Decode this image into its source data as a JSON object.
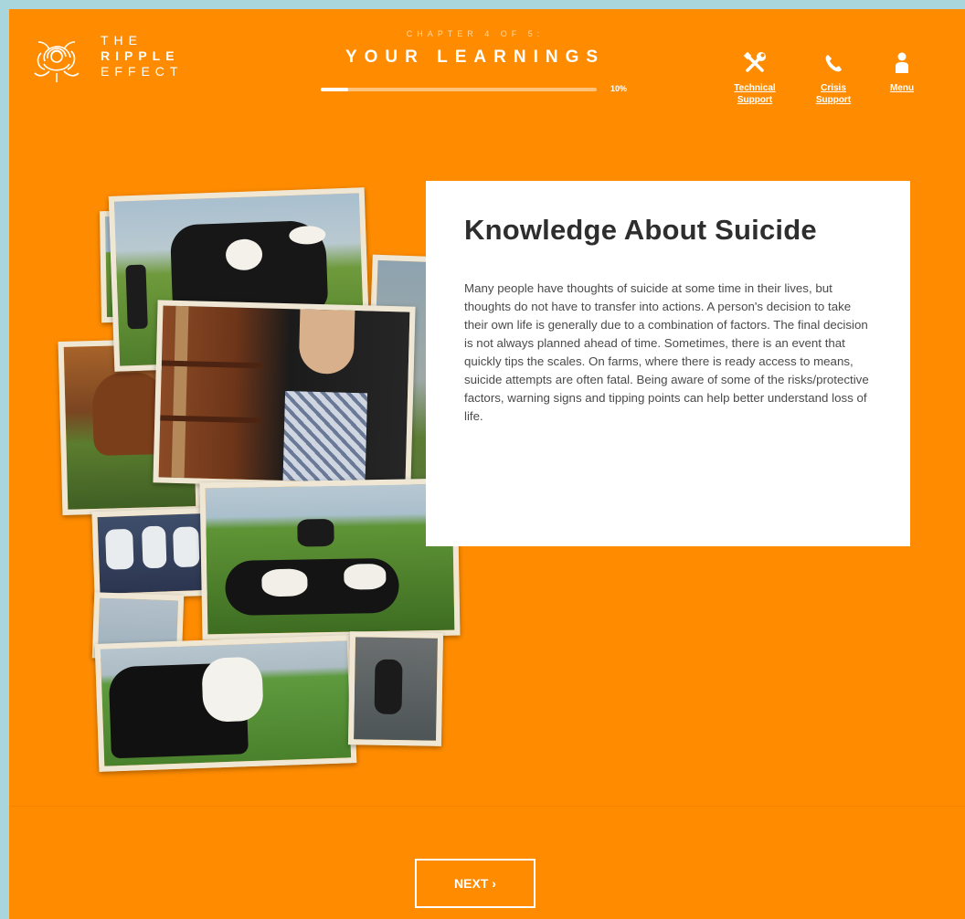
{
  "logo": {
    "line1": "THE",
    "line2": "RIPPLE",
    "line3": "EFFECT",
    "icon": "rose-logo-icon"
  },
  "header": {
    "chapter_label": "CHAPTER 4 OF 5:",
    "chapter_title": "YOUR LEARNINGS",
    "progress_percent": 10,
    "progress_text": "10%",
    "buttons": [
      {
        "label_line1": "Technical",
        "label_line2": "Support",
        "icon": "wrench-screwdriver-icon"
      },
      {
        "label_line1": "Crisis",
        "label_line2": "Support",
        "icon": "phone-icon"
      },
      {
        "label_line1": "Menu",
        "label_line2": "",
        "icon": "person-icon"
      }
    ]
  },
  "content": {
    "title": "Knowledge About Suicide",
    "body": "Many people have thoughts of suicide at some time in their lives, but thoughts do not have to transfer into actions. A person's decision to take their own life is generally due to a combination of factors. The final decision is not always planned ahead of time. Sometimes, there is an event that quickly tips the scales. On farms, where there is ready access to means, suicide attempts are often fatal. Being aware of some of the risks/protective factors, warning signs and tipping points can help better understand loss of life."
  },
  "footer": {
    "next_label": "NEXT ›"
  },
  "colors": {
    "background": "#ff8c00",
    "outer_border": "#a9d6dc",
    "card": "#ffffff",
    "title_text": "#2e2e2e"
  }
}
